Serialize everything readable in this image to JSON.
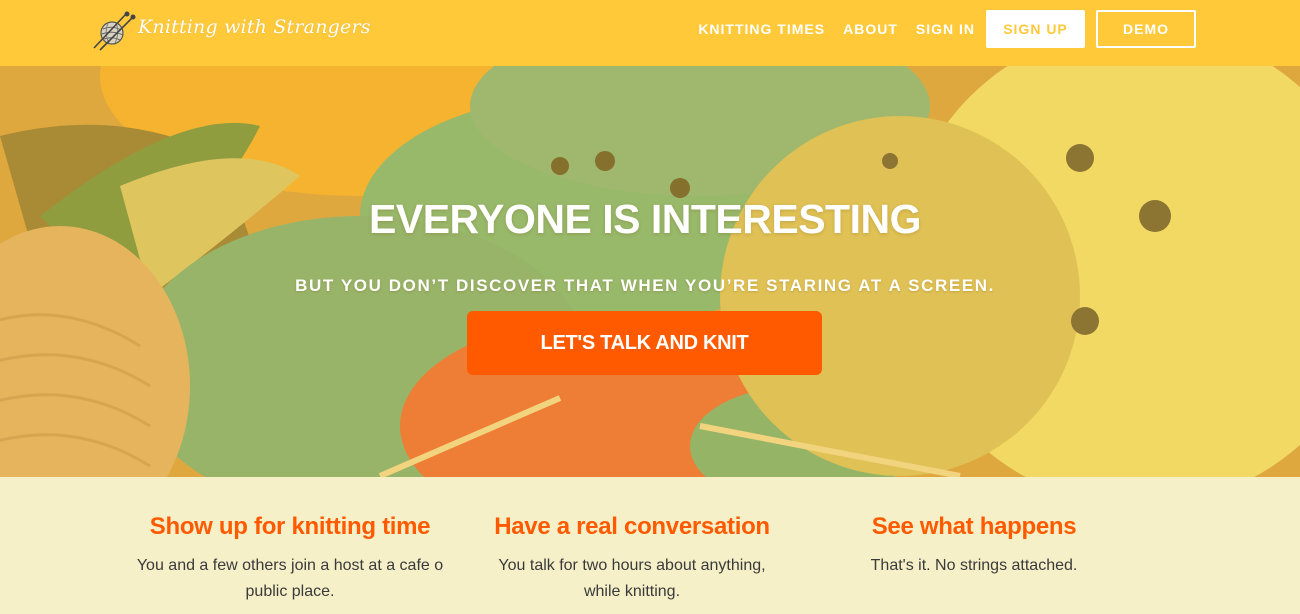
{
  "header": {
    "logo_text": "Knitting with Strangers",
    "logo_icon": "yarn-ball-with-needles-icon",
    "nav": {
      "knitting_times": "KNITTING TIMES",
      "about": "ABOUT",
      "sign_in": "SIGN IN",
      "sign_up": "SIGN UP",
      "demo": "DEMO"
    }
  },
  "hero": {
    "title": "EVERYONE IS INTERESTING",
    "subtitle": "BUT YOU DON’T DISCOVER THAT WHEN YOU’RE STARING AT A SCREEN.",
    "cta": "LET'S TALK AND KNIT"
  },
  "features": [
    {
      "title": "Show up for knitting time",
      "body": "You and a few others join a host at a cafe o public place."
    },
    {
      "title": "Have a real conversation",
      "body": "You talk for two hours about anything, while knitting."
    },
    {
      "title": "See what happens",
      "body": "That's it. No strings attached."
    }
  ],
  "colors": {
    "header_bg": "#ffc93a",
    "accent": "#ff5a00",
    "features_bg": "#f6f0c8",
    "text": "#3a3a3a"
  }
}
